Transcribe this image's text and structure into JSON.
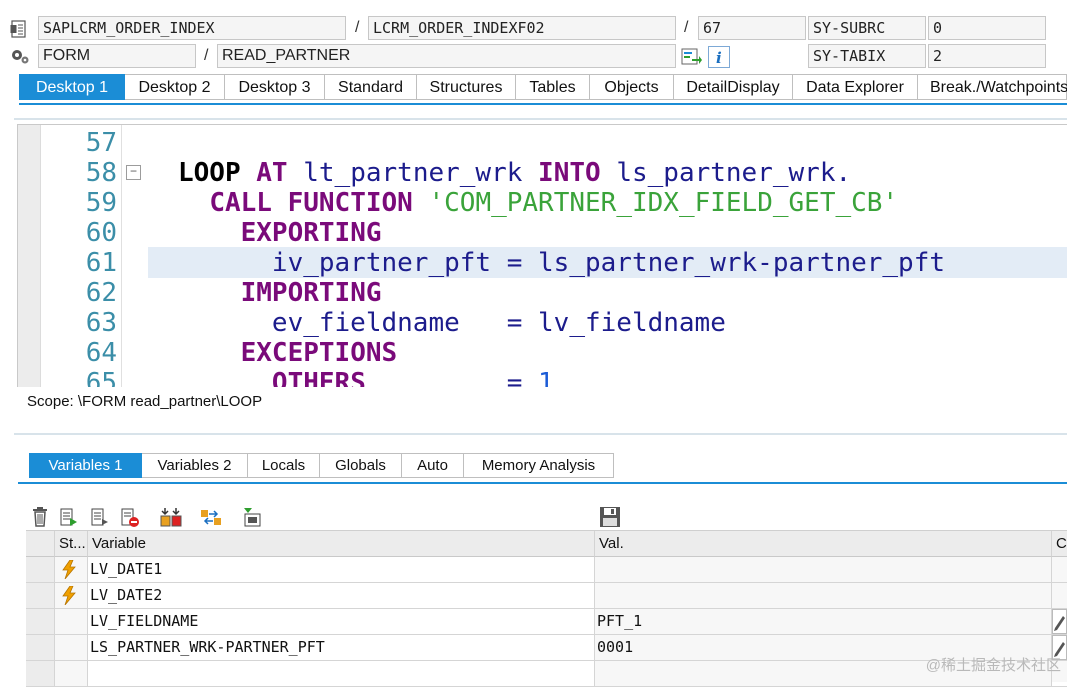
{
  "header": {
    "program": "SAPLCRM_ORDER_INDEX",
    "include": "LCRM_ORDER_INDEXF02",
    "line": "67",
    "subrc_label": "SY-SUBRC",
    "subrc_value": "0",
    "event_type": "FORM",
    "event_name": "READ_PARTNER",
    "tabix_label": "SY-TABIX",
    "tabix_value": "2",
    "sep1": "/",
    "sep2": "/",
    "sep3": "/"
  },
  "main_tabs": [
    "Desktop 1",
    "Desktop 2",
    "Desktop 3",
    "Standard",
    "Structures",
    "Tables",
    "Objects",
    "DetailDisplay",
    "Data Explorer",
    "Break./Watchpoints"
  ],
  "code": {
    "line_numbers": [
      "57",
      "58",
      "59",
      "60",
      "61",
      "62",
      "63",
      "64",
      "65"
    ],
    "lines": [
      {
        "parts": []
      },
      {
        "parts": [
          {
            "t": "LOOP",
            "c": "kwb"
          },
          {
            "t": " "
          },
          {
            "t": "AT",
            "c": "kw"
          },
          {
            "t": " lt_partner_wrk "
          },
          {
            "t": "INTO",
            "c": "kw"
          },
          {
            "t": " ls_partner_wrk."
          }
        ]
      },
      {
        "parts": [
          {
            "t": "  "
          },
          {
            "t": "CALL",
            "c": "kw"
          },
          {
            "t": " "
          },
          {
            "t": "FUNCTION",
            "c": "kw"
          },
          {
            "t": " "
          },
          {
            "t": "'COM_PARTNER_IDX_FIELD_GET_CB'",
            "c": "str"
          }
        ]
      },
      {
        "parts": [
          {
            "t": "    "
          },
          {
            "t": "EXPORTING",
            "c": "kw"
          }
        ]
      },
      {
        "parts": [
          {
            "t": "      iv_partner_pft = ls_partner_wrk-partner_pft"
          }
        ]
      },
      {
        "parts": [
          {
            "t": "    "
          },
          {
            "t": "IMPORTING",
            "c": "kw"
          }
        ]
      },
      {
        "parts": [
          {
            "t": "      ev_fieldname   = lv_fieldname"
          }
        ]
      },
      {
        "parts": [
          {
            "t": "    "
          },
          {
            "t": "EXCEPTIONS",
            "c": "kw"
          }
        ]
      },
      {
        "parts": [
          {
            "t": "      "
          },
          {
            "t": "OTHERS",
            "c": "kw"
          },
          {
            "t": "         = "
          },
          {
            "t": "1",
            "c": "num"
          }
        ]
      }
    ]
  },
  "scope": "Scope: \\FORM read_partner\\LOOP",
  "var_tabs": [
    "Variables 1",
    "Variables 2",
    "Locals",
    "Globals",
    "Auto",
    "Memory Analysis"
  ],
  "table": {
    "headers": {
      "status": "St...",
      "variable": "Variable",
      "value": "Val.",
      "extra": "C."
    },
    "rows": [
      {
        "changed": true,
        "variable": "LV_DATE1",
        "value": ""
      },
      {
        "changed": true,
        "variable": "LV_DATE2",
        "value": ""
      },
      {
        "changed": false,
        "variable": "LV_FIELDNAME",
        "value": "PFT_1"
      },
      {
        "changed": false,
        "variable": "LS_PARTNER_WRK-PARTNER_PFT",
        "value": "0001"
      },
      {
        "changed": false,
        "variable": "",
        "value": ""
      }
    ]
  },
  "watermark": "@稀土掘金技术社区",
  "colors": {
    "accent": "#1b8dd6",
    "keyword": "#7a0a7a",
    "string": "#3aa33a",
    "identifier": "#1c1c8c",
    "linenum": "#3b8ea8",
    "highlight": "#e3ecf6"
  },
  "icons": [
    "program-icon",
    "gear-icon",
    "navigate-icon",
    "info-icon",
    "delete-icon",
    "new-row-icon",
    "insert-row-icon",
    "remove-row-icon",
    "change-icon",
    "swap-icon",
    "import-icon",
    "save-icon",
    "lightning-icon"
  ]
}
